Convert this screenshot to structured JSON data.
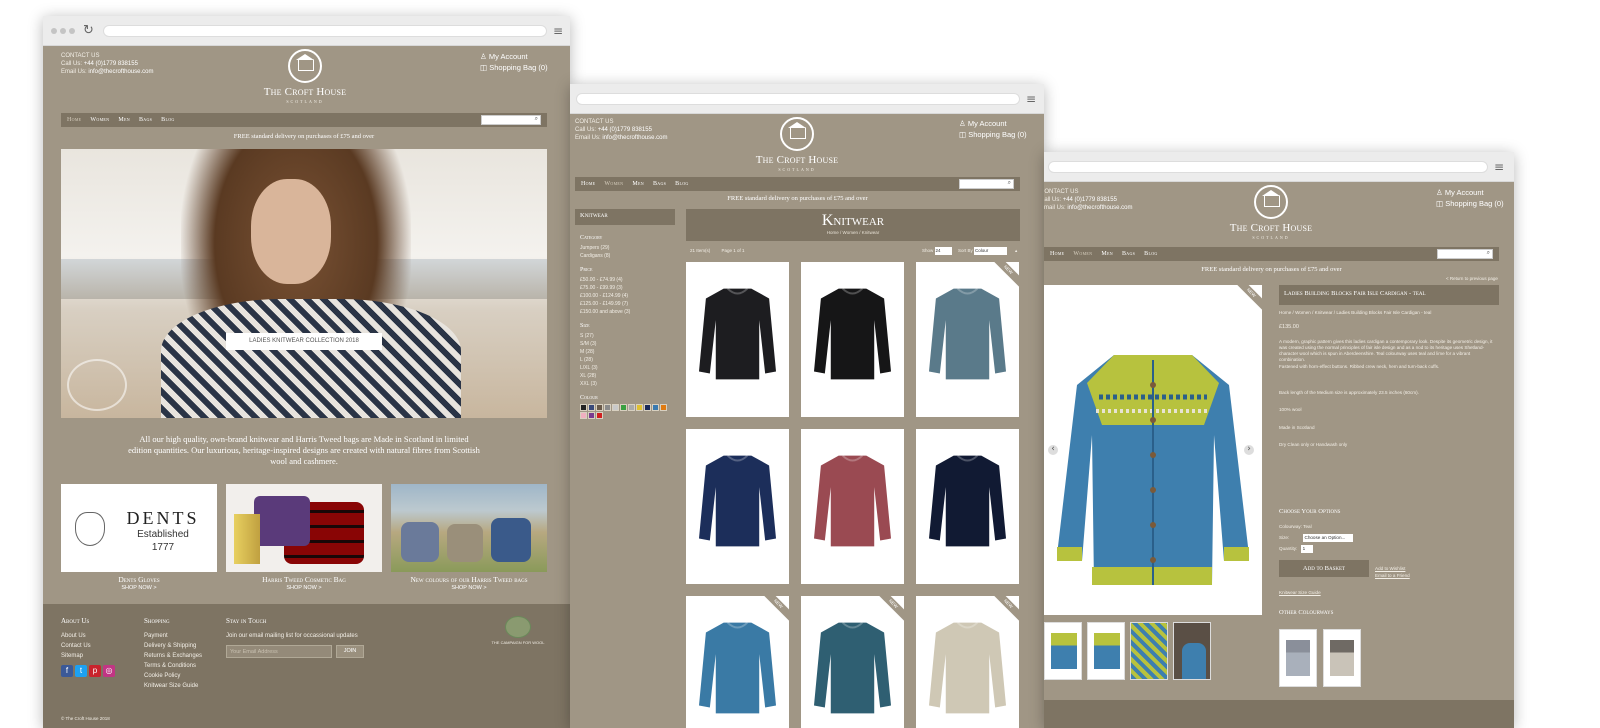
{
  "site": {
    "contact_title": "CONTACT US",
    "call_label": "Call Us:",
    "phone": "+44 (0)1779 838155",
    "email_label": "Email Us:",
    "email": "info@thecrofthouse.com",
    "logo_name": "The Croft House",
    "logo_sub": "SCOTLAND",
    "my_account": "My Account",
    "shopping_bag": "Shopping Bag (0)",
    "nav": [
      "Home",
      "Women",
      "Men",
      "Bags",
      "Blog"
    ],
    "search_placeholder": "Search",
    "delivery": "FREE standard delivery on purchases of £75 and over"
  },
  "home": {
    "hero_button": "LADIES KNITWEAR COLLECTION 2018",
    "intro": "All our high quality, own-brand knitwear and Harris Tweed bags are Made in Scotland in limited edition quantities. Our luxurious, heritage-inspired designs are created with natural fibres from Scottish wool and cashmere.",
    "tiles": [
      {
        "caption": "Dents Gloves",
        "shop": "SHOP NOW >"
      },
      {
        "caption": "Harris Tweed Cosmetic Bag",
        "shop": "SHOP NOW >"
      },
      {
        "caption": "New colours of our Harris Tweed bags",
        "shop": "SHOP NOW >"
      }
    ],
    "dents_brand": "DENTS",
    "dents_est": "Established",
    "dents_year": "1777",
    "footer": {
      "about_title": "About Us",
      "about_links": [
        "About Us",
        "Contact Us",
        "Sitemap"
      ],
      "shopping_title": "Shopping",
      "shopping_links": [
        "Payment",
        "Delivery & Shipping",
        "Returns & Exchanges",
        "Terms & Conditions",
        "Cookie Policy",
        "Knitwear Size Guide"
      ],
      "stay_title": "Stay in Touch",
      "stay_text": "Join our email mailing list for occassional updates",
      "email_placeholder": "Your Email Address",
      "join": "JOIN",
      "campaign": "THE CAMPAIGN FOR WOOL",
      "copyright": "© The Croft House 2018"
    }
  },
  "listing": {
    "sidebar_title": "Knitwear",
    "category_title": "Category",
    "categories": [
      "Jumpers (29)",
      "Cardigans (8)"
    ],
    "price_title": "Price",
    "prices": [
      "£50.00 - £74.99 (4)",
      "£75.00 - £99.99 (3)",
      "£100.00 - £124.99 (4)",
      "£125.00 - £149.99 (7)",
      "£150.00 and above (3)"
    ],
    "size_title": "Size",
    "sizes": [
      "S (27)",
      "S/M (3)",
      "M (28)",
      "L (28)",
      "L/XL (3)",
      "XL (28)",
      "XXL (3)"
    ],
    "colour_title": "Colour",
    "swatches": [
      "#222222",
      "#3a4a7a",
      "#6a5a4a",
      "#8a8a8a",
      "#c9c9c9",
      "#3aa040",
      "#aaaaaa",
      "#e0c030",
      "#1a2a5a",
      "#3a7ab0",
      "#e07a10",
      "#f0b0c0",
      "#7a3a90",
      "#d02020"
    ],
    "page_title": "Knitwear",
    "breadcrumb": "Home / Women / Knitwear",
    "items_count": "21 Item(s)",
    "page_info": "Page 1 of 1",
    "show_label": "Show",
    "show_value": "24",
    "sort_label": "Sort By",
    "sort_value": "Colour",
    "new_label": "NEW",
    "products": [
      {
        "color": "#1d1d20",
        "new": false
      },
      {
        "color": "#161617",
        "new": false
      },
      {
        "color": "#5a7a8a",
        "new": true
      },
      {
        "color": "#1c2e5a",
        "new": false
      },
      {
        "color": "#9a4a52",
        "new": false
      },
      {
        "color": "#111a33",
        "new": false
      },
      {
        "color": "#3a7aa5",
        "new": true
      },
      {
        "color": "#2f5f72",
        "new": true
      },
      {
        "color": "#cfc8b5",
        "new": true
      }
    ]
  },
  "product": {
    "return_link": "< Return to previous page",
    "title": "Ladies Building Blocks Fair Isle Cardigan - teal",
    "breadcrumb": "Home / Women / Knitwear / Ladies Building Blocks Fair Isle Cardigan - teal",
    "price": "£135.00",
    "description": "A modern, graphic pattern gives this ladies cardigan a contemporary look. Despite its geometric design, it was created using the normal principles of fair isle design and as a nod to its heritage uses Shetland-character wool which is spun in Aberdeenshire. Teal colourway uses teal and lime for a vibrant combination.",
    "fastening": "Fastened with horn-effect buttons. Ribbed crew neck, hem and turn-back cuffs.",
    "back_length": "Back length of the Medium size is approximately 23.5 inches (60cm).",
    "material": "100% wool",
    "origin": "Made in Scotland",
    "care": "Dry Clean only or Handwash only",
    "options_title": "Choose Your Options",
    "colourway_label": "Colourway: Teal",
    "size_label": "Size:",
    "size_value": "Choose an Option...",
    "qty_label": "Quantity:",
    "qty_value": "1",
    "add_button": "Add to Basket",
    "wishlist": "Add to Wishlist",
    "email_friend": "Email to a Friend",
    "size_guide": "Knitwear Size Guide",
    "other_title": "Other Colourways",
    "new_label": "NEW",
    "prev_arrow": "‹",
    "next_arrow": "›"
  }
}
